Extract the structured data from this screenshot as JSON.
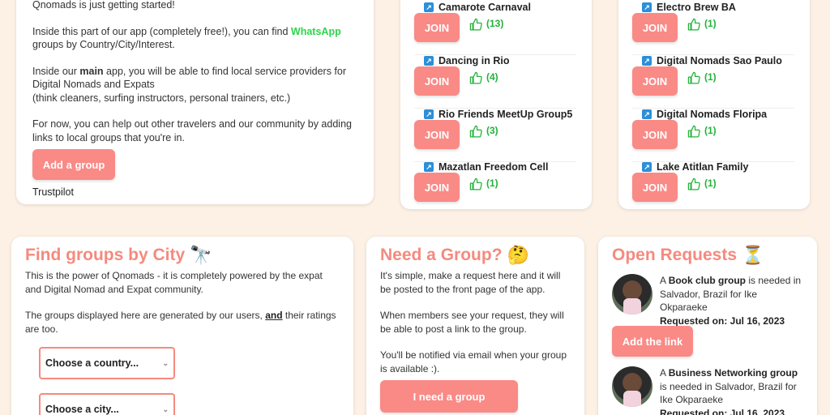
{
  "intro": {
    "line_top": "Qnomads is just getting started!",
    "p1_a": "Inside this part of our app (completely free!), you can find ",
    "p1_wa": "WhatsApp",
    "p1_b": " groups by Country/City/Interest.",
    "p2_a": "Inside our ",
    "p2_main": "main",
    "p2_b": " app, you will be able to find local service providers for Digital Nomads and Expats",
    "p2_c": "(think cleaners, surfing instructors, personal trainers, etc.)",
    "p3": "For now, you can help out other travelers and our community by adding links to local groups that you're in.",
    "add_group_label": "Add a group",
    "trustpilot": "Trustpilot"
  },
  "groups_col1": [
    {
      "name": "Camarote Carnaval",
      "likes": "(13)"
    },
    {
      "name": "Dancing in Rio",
      "likes": "(4)"
    },
    {
      "name": "Rio Friends MeetUp Group5",
      "likes": "(3)"
    },
    {
      "name": "Mazatlan Freedom Cell",
      "likes": "(1)"
    }
  ],
  "groups_col2": [
    {
      "name": "Electro Brew BA",
      "likes": "(1)"
    },
    {
      "name": "Digital Nomads Sao Paulo",
      "likes": "(1)"
    },
    {
      "name": "Digital Nomads Floripa",
      "likes": "(1)"
    },
    {
      "name": "Lake Atitlan Family",
      "likes": "(1)"
    }
  ],
  "join_label": "JOIN",
  "city": {
    "title": "Find groups by City",
    "emoji": "🔭",
    "p1": "This is the power of Qnomads - it is completely powered by the expat and Digital Nomad and Expat community.",
    "p2_a": "The groups displayed here are generated by our users, ",
    "p2_and": "and",
    "p2_b": " their ratings are too.",
    "country_placeholder": "Choose a country...",
    "city_placeholder": "Choose a city..."
  },
  "need": {
    "title": "Need a Group?",
    "emoji": "🤔",
    "p1": "It's simple, make a request here and it will be posted to the front page of the app.",
    "p2": "When members see your request, they will be able to post a link to the group.",
    "p3": "You'll be notified via email when your group is available :).",
    "button": "I need a group"
  },
  "open": {
    "title": "Open Requests",
    "emoji": "⏳",
    "requests": [
      {
        "a": "A ",
        "group": "Book club group",
        "b": " is needed in Salvador, Brazil for Ike Okparaeke",
        "requested": "Requested on: Jul 16, 2023"
      },
      {
        "a": "A ",
        "group": "Business Networking group",
        "b": " is needed in Salvador, Brazil for Ike Okparaeke",
        "requested": "Requested on: Jul 16, 2023"
      }
    ],
    "add_link_label": "Add the link"
  },
  "colors": {
    "accent": "#f98a86",
    "heading": "#f58a7e",
    "whatsapp": "#2dd44a",
    "like": "#22b33a",
    "background": "#fdf1e6"
  }
}
